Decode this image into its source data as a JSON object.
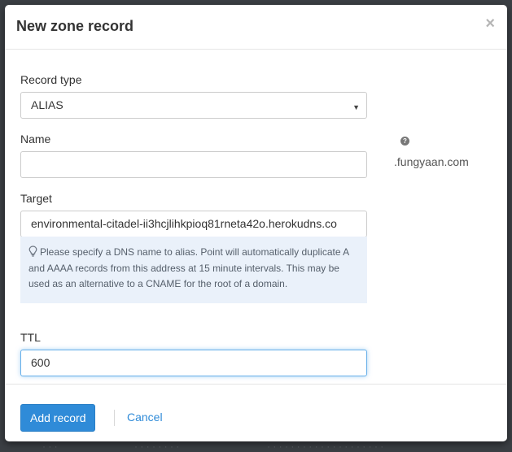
{
  "modal": {
    "title": "New zone record",
    "close_glyph": "×"
  },
  "form": {
    "record_type": {
      "label": "Record type",
      "value": "ALIAS",
      "help_icon": "question-circle-icon"
    },
    "name": {
      "label": "Name",
      "value": "",
      "suffix": ".fungyaan.com"
    },
    "target": {
      "label": "Target",
      "value": "environmental-citadel-ii3hcjlihkpioq81rneta42o.herokudns.co",
      "help_icon": "lightbulb-icon",
      "help_text": "Please specify a DNS name to alias. Point will automatically duplicate A and AAAA records from this address at 15 minute intervals. This may be used as an alternative to a CNAME for the root of a domain."
    },
    "ttl": {
      "label": "TTL",
      "value": "600"
    }
  },
  "footer": {
    "submit_label": "Add record",
    "cancel_label": "Cancel"
  },
  "colors": {
    "primary": "#2f8bd8",
    "help_bg": "#eaf1fa",
    "focus_border": "#66afe9"
  }
}
